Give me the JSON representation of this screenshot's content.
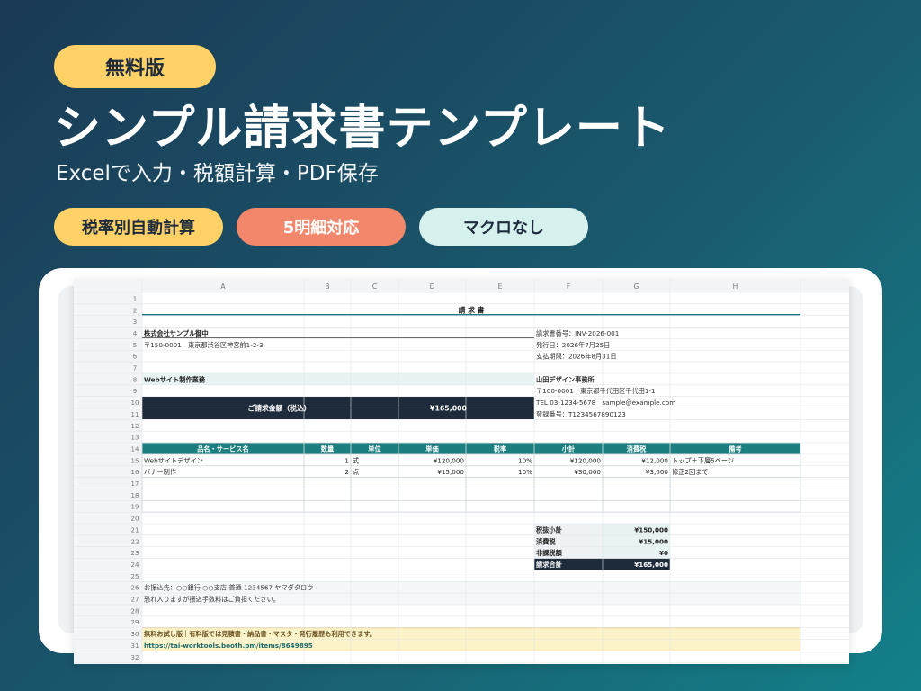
{
  "hero": {
    "badge": "無料版",
    "title": "シンプル請求書テンプレート",
    "subtitle": "Excelで入力・税額計算・PDF保存",
    "pills": [
      "税率別自動計算",
      "5明細対応",
      "マクロなし"
    ]
  },
  "sheet": {
    "columns": [
      "A",
      "B",
      "C",
      "D",
      "E",
      "F",
      "G",
      "H"
    ],
    "rows": [
      "1",
      "2",
      "3",
      "4",
      "5",
      "6",
      "7",
      "8",
      "9",
      "10",
      "11",
      "12",
      "13",
      "14",
      "15",
      "16",
      "17",
      "18",
      "19",
      "20",
      "21",
      "22",
      "23",
      "24",
      "25",
      "26",
      "27",
      "28",
      "29",
      "30",
      "31",
      "32"
    ],
    "doc_title": "請 求 書",
    "client_name": "株式会社サンプル御中",
    "client_address": "〒150-0001　東京都渋谷区神宮前1-2-3",
    "subject": "Webサイト制作業務",
    "total_label": "ご請求金額（税込）",
    "total_value": "¥165,000",
    "invoice_meta": [
      "請求書番号：INV-2026-001",
      "発行日：2026年7月25日",
      "支払期限：2026年8月31日"
    ],
    "issuer": [
      "山田デザイン事務所",
      "〒100-0001　東京都千代田区千代田1-1",
      "TEL 03-1234-5678　sample@example.com",
      "登録番号：T1234567890123"
    ],
    "table_headers": [
      "品名・サービス名",
      "数量",
      "単位",
      "単価",
      "税率",
      "小計",
      "消費税",
      "備考"
    ],
    "items": [
      [
        "Webサイトデザイン",
        "1",
        "式",
        "¥120,000",
        "10%",
        "¥120,000",
        "¥12,000",
        "トップ＋下層5ページ"
      ],
      [
        "バナー制作",
        "2",
        "点",
        "¥15,000",
        "10%",
        "¥30,000",
        "¥3,000",
        "修正2回まで"
      ]
    ],
    "summary": [
      [
        "税抜小計",
        "¥150,000"
      ],
      [
        "消費税",
        "¥15,000"
      ],
      [
        "非課税額",
        "¥0"
      ],
      [
        "請求合計",
        "¥165,000"
      ]
    ],
    "bank_info": "お振込先：○○銀行 ○○支店 普通 1234567 ヤマダタロウ",
    "bank_note": "恐れ入りますが振込手数料はご負担ください。",
    "promo_line": "無料お試し版｜有料版では見積書・納品書・マスタ・発行履歴も利用できます。",
    "promo_url": "https://tai-worktools.booth.pm/items/8649895"
  },
  "colors": {
    "teal": "#1b7f80",
    "navy": "#1d2b3a",
    "yellow": "#ffd166",
    "coral": "#f2876c",
    "mint": "#d6f0ee"
  }
}
